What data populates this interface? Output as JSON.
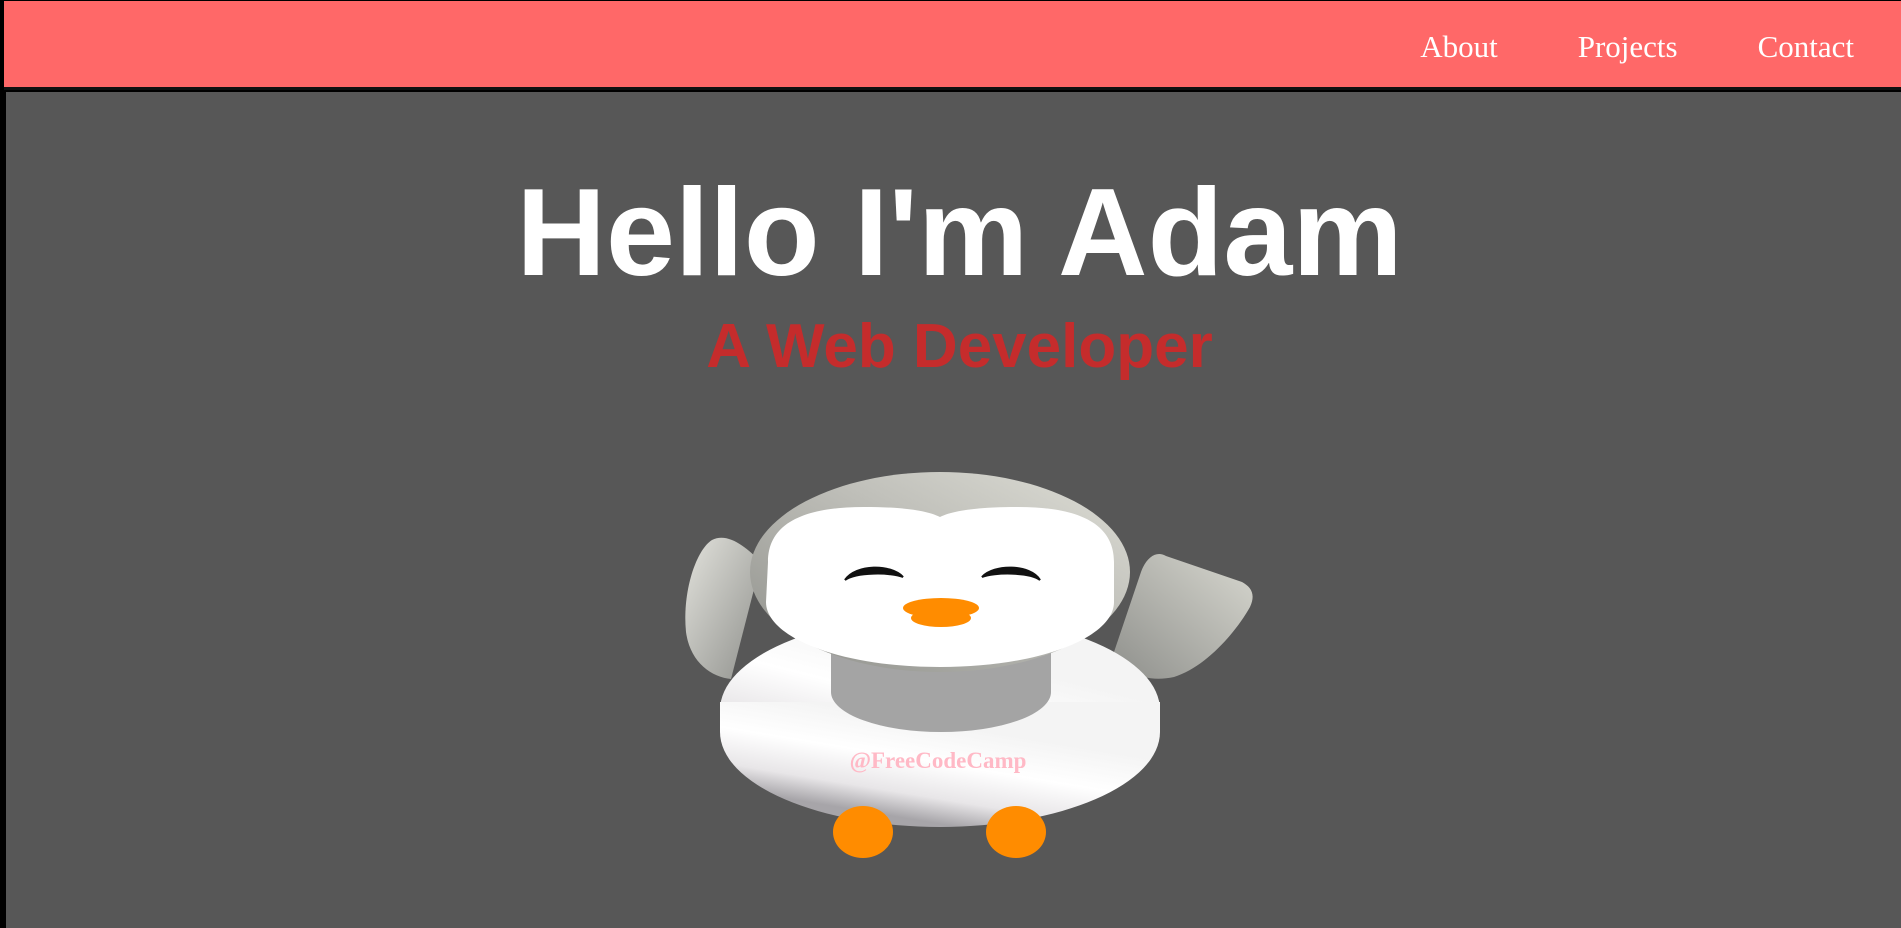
{
  "nav": {
    "links": [
      {
        "label": "About"
      },
      {
        "label": "Projects"
      },
      {
        "label": "Contact"
      }
    ]
  },
  "hero": {
    "title": "Hello I'm Adam",
    "subtitle": "A Web Developer"
  },
  "penguin": {
    "watermark": "@FreeCodeCamp"
  },
  "colors": {
    "navbar": "#ff6868",
    "background": "#575757",
    "subtitle": "#c52c2c",
    "beak_feet": "#ff8c00"
  }
}
